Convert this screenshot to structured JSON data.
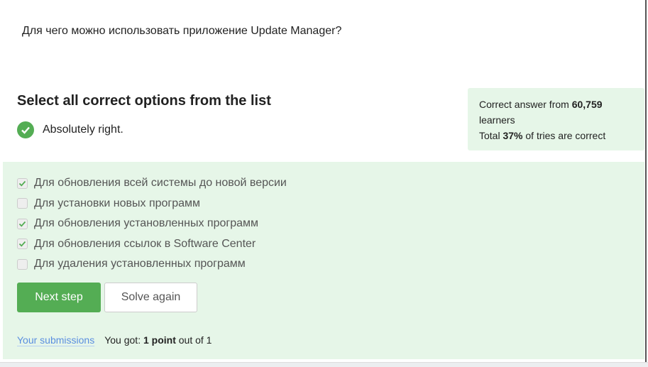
{
  "question": "Для чего можно использовать приложение Update Manager?",
  "instruction": "Select all correct options from the list",
  "result": {
    "text": "Absolutely right.",
    "icon": "check-circle-icon",
    "color": "#54ad54"
  },
  "stats": {
    "line1_prefix": "Correct answer from ",
    "learners_count": "60,759",
    "line1_suffix": "learners",
    "line2_prefix": "Total ",
    "percent": "37%",
    "line2_suffix": " of tries are correct"
  },
  "options": [
    {
      "label": "Для обновления всей системы до новой версии",
      "checked": true
    },
    {
      "label": "Для установки новых программ",
      "checked": false
    },
    {
      "label": "Для обновления установленных программ",
      "checked": true
    },
    {
      "label": "Для обновления ссылок в Software Center",
      "checked": true
    },
    {
      "label": "Для удаления установленных программ",
      "checked": false
    }
  ],
  "buttons": {
    "next": "Next step",
    "solve_again": "Solve again"
  },
  "footer": {
    "submissions_link": "Your submissions",
    "score_prefix": "You got: ",
    "score_bold": "1 point",
    "score_suffix": " out of 1"
  }
}
